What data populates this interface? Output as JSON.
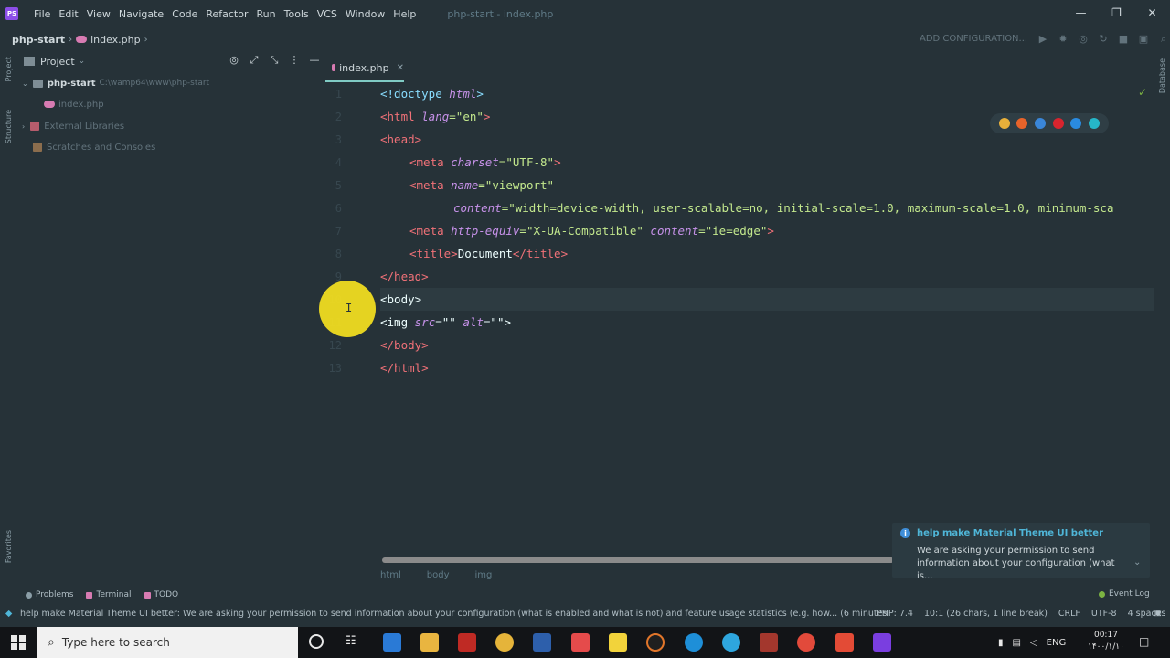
{
  "window": {
    "menu": [
      "File",
      "Edit",
      "View",
      "Navigate",
      "Code",
      "Refactor",
      "Run",
      "Tools",
      "VCS",
      "Window",
      "Help"
    ],
    "title": "php-start - index.php",
    "controls": {
      "minimize": "—",
      "restore": "❐",
      "close": "✕"
    }
  },
  "navbar": {
    "project": "php-start",
    "file": "index.php",
    "add_configuration": "ADD CONFIGURATION..."
  },
  "side_stripe": {
    "project": "Project",
    "structure": "Structure",
    "favorites": "Favorites",
    "database": "Database"
  },
  "project_panel": {
    "title": "Project",
    "root_name": "php-start",
    "root_path": "C:\\wamp64\\www\\php-start",
    "file": "index.php",
    "external_libraries": "External Libraries",
    "scratches": "Scratches and Consoles"
  },
  "editor": {
    "tab": "index.php",
    "line_numbers": [
      "1",
      "2",
      "3",
      "4",
      "5",
      "6",
      "7",
      "8",
      "9",
      "10",
      "11",
      "12",
      "13"
    ],
    "code": {
      "l1_a": "<!doctype ",
      "l1_b": "html",
      "l1_c": ">",
      "l2_a": "<html ",
      "l2_b": "lang",
      "l2_c": "=\"en\"",
      "l2_d": ">",
      "l3": "<head>",
      "l4_a": "<meta ",
      "l4_b": "charset",
      "l4_c": "=\"UTF-8\"",
      "l4_d": ">",
      "l5_a": "<meta ",
      "l5_b": "name",
      "l5_c": "=\"viewport\"",
      "l6_a": "content",
      "l6_b": "=\"width=device-width, user-scalable=no, initial-scale=1.0, maximum-scale=1.0, minimum-sca",
      "l7_a": "<meta ",
      "l7_b": "http-equiv",
      "l7_c": "=\"X-UA-Compatible\" ",
      "l7_d": "content",
      "l7_e": "=\"ie=edge\"",
      "l7_f": ">",
      "l8_a": "<title>",
      "l8_b": "Document",
      "l8_c": "</title>",
      "l9": "</head>",
      "l10": "<body>",
      "l11_a": "<img ",
      "l11_b": "src",
      "l11_c": "=\"\" ",
      "l11_d": "alt",
      "l11_e": "=\"\"",
      "l11_f": ">",
      "l12": "</body>",
      "l13": "</html>"
    },
    "breadcrumb": [
      "html",
      "body",
      "img"
    ]
  },
  "notification": {
    "title": "help make Material Theme UI better",
    "body": "We are asking your permission to send information about your configuration (what is..."
  },
  "tool_windows": {
    "problems": "Problems",
    "terminal": "Terminal",
    "todo": "TODO",
    "event_log": "Event Log"
  },
  "status": {
    "message": "help make Material Theme UI better: We are asking your permission to send information about your configuration (what is enabled and what is not) and feature usage statistics (e.g. how... (6 minutes",
    "php": "PHP: 7.4",
    "position": "10:1 (26 chars, 1 line break)",
    "line_sep": "CRLF",
    "encoding": "UTF-8",
    "indent": "4 spaces"
  },
  "taskbar": {
    "search_placeholder": "Type here to search",
    "language": "ENG",
    "time": "00:17",
    "date": "۱۴۰۰/۱/۱۰"
  }
}
